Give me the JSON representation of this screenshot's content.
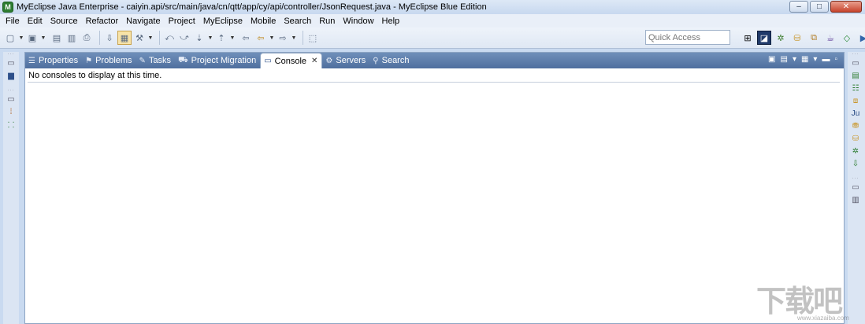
{
  "window": {
    "title": "MyEclipse Java Enterprise - caiyin.api/src/main/java/cn/qtt/app/cy/api/controller/JsonRequest.java - MyEclipse Blue Edition",
    "minimize": "–",
    "maximize": "□",
    "close": "✕"
  },
  "menu": [
    "File",
    "Edit",
    "Source",
    "Refactor",
    "Navigate",
    "Project",
    "MyEclipse",
    "Mobile",
    "Search",
    "Run",
    "Window",
    "Help"
  ],
  "toolbar": {
    "quick_access_placeholder": "Quick Access"
  },
  "view": {
    "tabs": [
      {
        "label": "Properties",
        "icon": "properties-icon"
      },
      {
        "label": "Problems",
        "icon": "problems-icon"
      },
      {
        "label": "Tasks",
        "icon": "tasks-icon"
      },
      {
        "label": "Project Migration",
        "icon": "migration-icon"
      },
      {
        "label": "Console",
        "icon": "console-icon",
        "active": true
      },
      {
        "label": "Servers",
        "icon": "servers-icon"
      },
      {
        "label": "Search",
        "icon": "search-icon"
      }
    ],
    "console_message": "No consoles to display at this time."
  },
  "colors": {
    "tab_bar": "#5a7aab",
    "active_perspective": "#203a6a"
  },
  "watermark": {
    "text": "下载吧",
    "url": "www.xiazaiba.com"
  }
}
